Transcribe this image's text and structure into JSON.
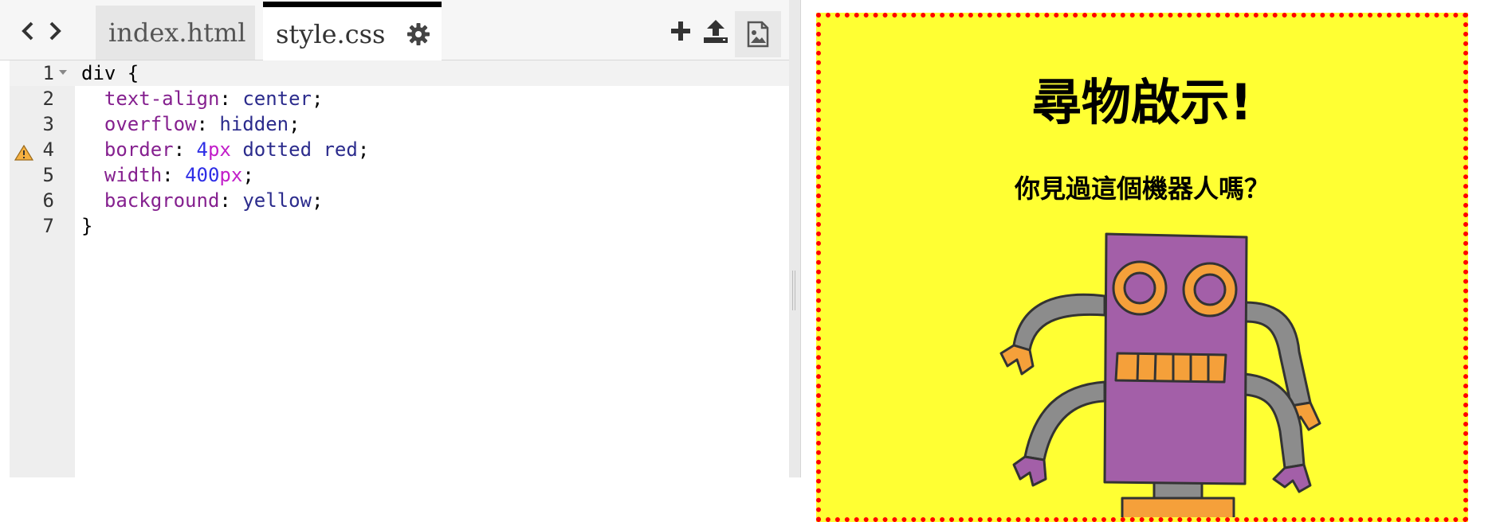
{
  "toolbar": {
    "tabs": [
      {
        "label": "index.html",
        "active": false
      },
      {
        "label": "style.css",
        "active": true
      }
    ],
    "icons": [
      "chevron-left-icon",
      "chevron-right-icon",
      "gear-icon",
      "plus-icon",
      "upload-icon",
      "image-icon"
    ]
  },
  "editor": {
    "lines": [
      {
        "num": "1",
        "text": "div {"
      },
      {
        "num": "2",
        "prop": "text-align",
        "value": "center"
      },
      {
        "num": "3",
        "prop": "overflow",
        "value": "hidden"
      },
      {
        "num": "4",
        "prop": "border",
        "value_num": "4",
        "value_unit": "px",
        "value_rest": "dotted red",
        "warning": true
      },
      {
        "num": "5",
        "prop": "width",
        "value_num": "400",
        "value_unit": "px"
      },
      {
        "num": "6",
        "prop": "background",
        "value": "yellow"
      },
      {
        "num": "7",
        "text": "}"
      }
    ]
  },
  "preview": {
    "heading": "尋物啟示!",
    "subheading": "你見過這個機器人嗎？",
    "colors": {
      "background": "#ffff33",
      "border": "#ff0000"
    }
  }
}
